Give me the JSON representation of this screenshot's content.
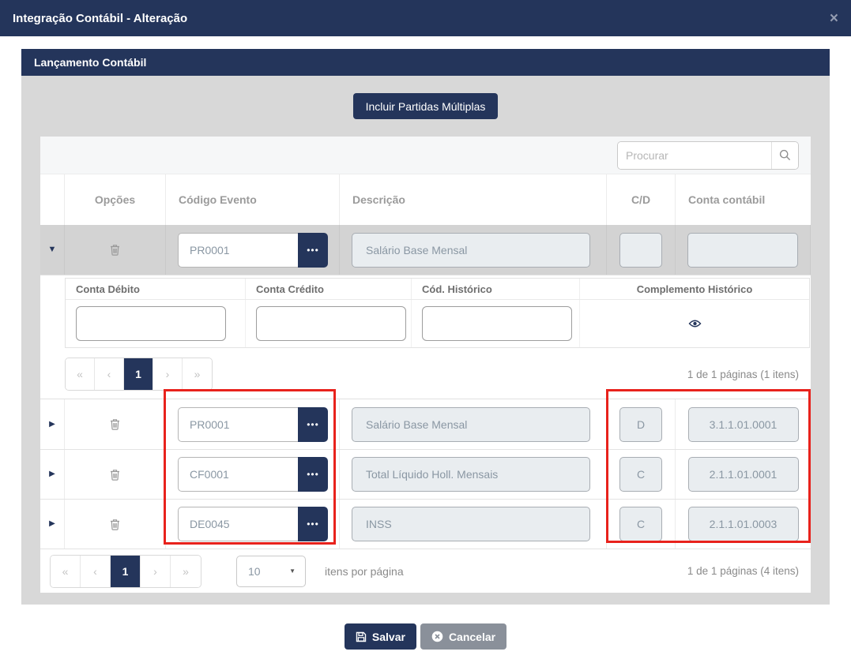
{
  "modal": {
    "title": "Integração Contábil - Alteração",
    "close_glyph": "×"
  },
  "panel": {
    "title": "Lançamento Contábil"
  },
  "actions": {
    "include_multiple": "Incluir Partidas Múltiplas",
    "save": "Salvar",
    "cancel": "Cancelar"
  },
  "search": {
    "placeholder": "Procurar"
  },
  "icons": {
    "expand_open_glyph": "▼",
    "expand_closed_glyph": "▶",
    "more_glyph": "•••",
    "caret_glyph": "▼"
  },
  "table": {
    "headers": {
      "options": "Opções",
      "event_code": "Código Evento",
      "description": "Descrição",
      "cd": "C/D",
      "account": "Conta contábil"
    },
    "rows": [
      {
        "code": "PR0001",
        "description": "Salário Base Mensal",
        "cd": "",
        "account": ""
      },
      {
        "code": "PR0001",
        "description": "Salário Base Mensal",
        "cd": "D",
        "account": "3.1.1.01.0001"
      },
      {
        "code": "CF0001",
        "description": "Total Líquido Holl. Mensais",
        "cd": "C",
        "account": "2.1.1.01.0001"
      },
      {
        "code": "DE0045",
        "description": "INSS",
        "cd": "C",
        "account": "2.1.1.01.0003"
      }
    ]
  },
  "detail": {
    "headers": {
      "debit": "Conta Débito",
      "credit": "Conta Crédito",
      "history_code": "Cód. Histórico",
      "history_complement": "Complemento Histórico"
    },
    "pagination": {
      "first": "«",
      "prev": "‹",
      "page": "1",
      "next": "›",
      "last": "»",
      "info": "1 de 1 páginas (1 itens)"
    }
  },
  "pagination": {
    "first": "«",
    "prev": "‹",
    "page": "1",
    "next": "›",
    "last": "»",
    "page_size": "10",
    "items_label": "itens por página",
    "info": "1 de 1 páginas (4 itens)"
  },
  "colors": {
    "navy": "#24355b",
    "highlight_red": "#e8221c",
    "body_gray": "#d8d8d8"
  }
}
